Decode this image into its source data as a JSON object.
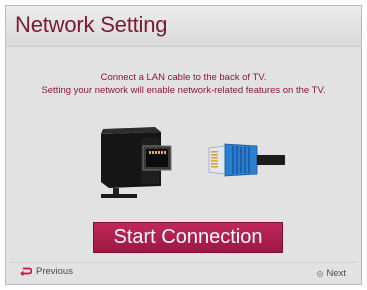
{
  "dialog": {
    "title": "Network Setting",
    "message_line1": "Connect a LAN cable to the back of TV.",
    "message_line2": "Setting your network will enable network-related features on the TV.",
    "start_label": "Start Connection",
    "previous_label": "Previous",
    "next_label": "Next"
  },
  "icons": {
    "previous": "return-arrow-icon",
    "next": "ok-button-icon",
    "illustration": [
      "tv-lan-port-icon",
      "lan-cable-connector-icon"
    ]
  },
  "colors": {
    "title": "#7b1a33",
    "message": "#8a1832",
    "button": "#ac1f4e",
    "previous_arrow": "#c8143c",
    "cable": "#2a7fd0"
  }
}
